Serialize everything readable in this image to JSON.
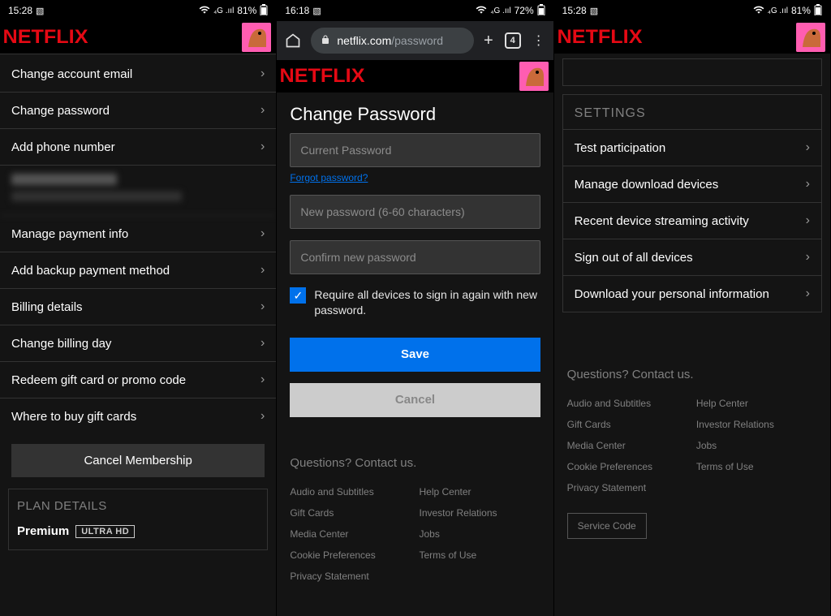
{
  "panel1": {
    "status": {
      "time": "15:28",
      "battery": "81%"
    },
    "logo": "NETFLIX",
    "rows": [
      "Change account email",
      "Change password",
      "Add phone number"
    ],
    "rows2": [
      "Manage payment info",
      "Add backup payment method",
      "Billing details",
      "Change billing day",
      "Redeem gift card or promo code",
      "Where to buy gift cards"
    ],
    "cancel_membership": "Cancel Membership",
    "plan_details_title": "PLAN DETAILS",
    "premium": "Premium",
    "uhd": "ULTRA HD"
  },
  "panel2": {
    "status": {
      "time": "16:18",
      "battery": "72%"
    },
    "url_domain": "netflix.com",
    "url_path": "/password",
    "tab_count": "4",
    "logo": "NETFLIX",
    "title": "Change Password",
    "placeholders": {
      "current": "Current Password",
      "newp": "New password (6-60 characters)",
      "confirm": "Confirm new password"
    },
    "forgot": "Forgot password?",
    "checkbox_label": "Require all devices to sign in again with new password.",
    "save": "Save",
    "cancel": "Cancel",
    "questions": "Questions? Contact us.",
    "links_left": [
      "Audio and Subtitles",
      "Gift Cards",
      "Media Center",
      "Cookie Preferences",
      "Privacy Statement"
    ],
    "links_right": [
      "Help Center",
      "Investor Relations",
      "Jobs",
      "Terms of Use"
    ]
  },
  "panel3": {
    "status": {
      "time": "15:28",
      "battery": "81%"
    },
    "logo": "NETFLIX",
    "settings_title": "SETTINGS",
    "rows": [
      "Test participation",
      "Manage download devices",
      "Recent device streaming activity",
      "Sign out of all devices",
      "Download your personal information"
    ],
    "questions": "Questions? Contact us.",
    "links_left": [
      "Audio and Subtitles",
      "Gift Cards",
      "Media Center",
      "Cookie Preferences",
      "Privacy Statement"
    ],
    "links_right": [
      "Help Center",
      "Investor Relations",
      "Jobs",
      "Terms of Use"
    ],
    "service_code": "Service Code"
  }
}
